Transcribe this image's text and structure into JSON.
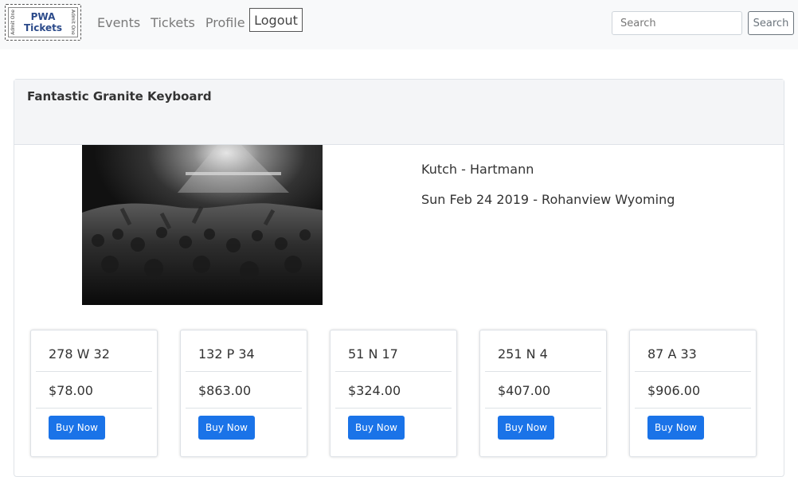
{
  "navbar": {
    "logo": {
      "line1": "PWA",
      "line2": "Tickets",
      "side_left": "Admit One",
      "side_right": "Admit One"
    },
    "links": [
      "Events",
      "Tickets",
      "Profile"
    ],
    "logout_label": "Logout",
    "search_placeholder": "Search",
    "search_button_label": "Search"
  },
  "event": {
    "title": "Fantastic Granite Keyboard",
    "venue": "Kutch - Hartmann",
    "date_location": "Sun Feb 24 2019 - Rohanview Wyoming"
  },
  "tickets": [
    {
      "seat": "278 W 32",
      "price": "$78.00",
      "button": "Buy Now"
    },
    {
      "seat": "132 P 34",
      "price": "$863.00",
      "button": "Buy Now"
    },
    {
      "seat": "51 N 17",
      "price": "$324.00",
      "button": "Buy Now"
    },
    {
      "seat": "251 N 4",
      "price": "$407.00",
      "button": "Buy Now"
    },
    {
      "seat": "87 A 33",
      "price": "$906.00",
      "button": "Buy Now"
    }
  ],
  "colors": {
    "accent": "#1a73e8",
    "navbar_bg": "#f8f9fa"
  }
}
